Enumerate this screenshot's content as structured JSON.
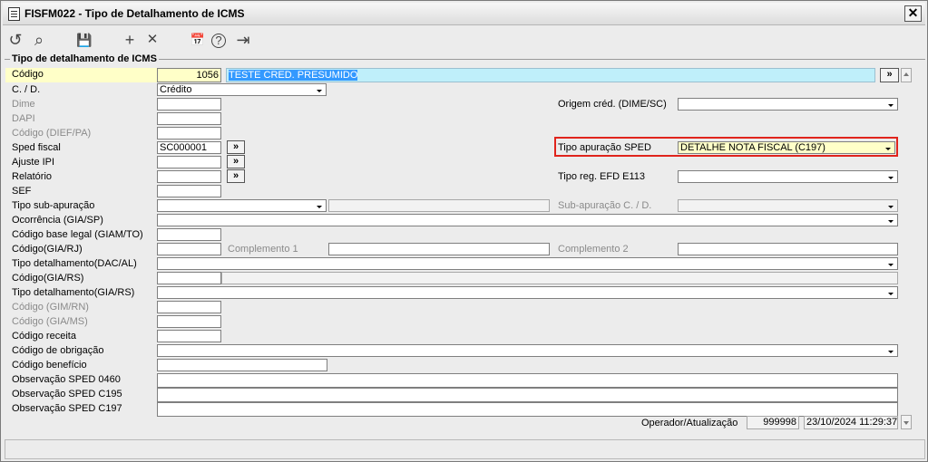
{
  "window": {
    "title": "FISFM022 - Tipo de Detalhamento de ICMS",
    "close_label": "✕"
  },
  "toolbar": {
    "undo_icon": "↺",
    "search_icon": "⌕",
    "save_icon": "💾",
    "add_icon": "+",
    "delete_icon": "✕",
    "calendar_icon": "📅",
    "help_icon": "?",
    "exit_icon": "⇥"
  },
  "group_title": "Tipo de detalhamento de ICMS",
  "left": {
    "codigo": {
      "label": "Código",
      "value": "1056",
      "desc": "TESTE CRED. PRESUMIDO"
    },
    "cd": {
      "label": "C. / D.",
      "value": "Crédito"
    },
    "dime": {
      "label": "Dime"
    },
    "dapi": {
      "label": "DAPI"
    },
    "codigo_diefpa": {
      "label": "Código (DIEF/PA)"
    },
    "sped_fiscal": {
      "label": "Sped fiscal",
      "value": "SC000001"
    },
    "ajuste_ipi": {
      "label": "Ajuste IPI"
    },
    "relatorio": {
      "label": "Relatório"
    },
    "sef": {
      "label": "SEF"
    },
    "tipo_subapuracao": {
      "label": "Tipo sub-apuração"
    },
    "ocorrencia": {
      "label": "Ocorrência (GIA/SP)"
    },
    "cod_base_legal": {
      "label": "Código base legal (GIAM/TO)"
    },
    "codigo_giarj": {
      "label": "Código(GIA/RJ)"
    },
    "tipo_dacal": {
      "label": "Tipo detalhamento(DAC/AL)"
    },
    "codigo_giars": {
      "label": "Código(GIA/RS)"
    },
    "tipo_giars": {
      "label": "Tipo detalhamento(GIA/RS)"
    },
    "codigo_gimrn": {
      "label": "Código (GIM/RN)"
    },
    "codigo_giams": {
      "label": "Código (GIA/MS)"
    },
    "codigo_receita": {
      "label": "Código receita"
    },
    "codigo_obrigacao": {
      "label": "Código de obrigação"
    },
    "codigo_beneficio": {
      "label": "Código benefício"
    },
    "obs_0460": {
      "label": "Observação SPED 0460"
    },
    "obs_c195": {
      "label": "Observação SPED C195"
    },
    "obs_c197": {
      "label": "Observação SPED C197"
    }
  },
  "right": {
    "origem_cred": {
      "label": "Origem créd. (DIME/SC)"
    },
    "tipo_apuracao": {
      "label": "Tipo apuração SPED",
      "value": "DETALHE NOTA FISCAL (C197)"
    },
    "tipo_reg_efd": {
      "label": "Tipo reg. EFD E113"
    },
    "subapuracao_cd": {
      "label": "Sub-apuração C. / D."
    },
    "complemento1": {
      "label": "Complemento 1"
    },
    "complemento2": {
      "label": "Complemento 2"
    }
  },
  "footer": {
    "label": "Operador/Atualização",
    "operator": "999998",
    "datetime": "23/10/2024 11:29:37"
  },
  "buttons": {
    "more": "»"
  }
}
